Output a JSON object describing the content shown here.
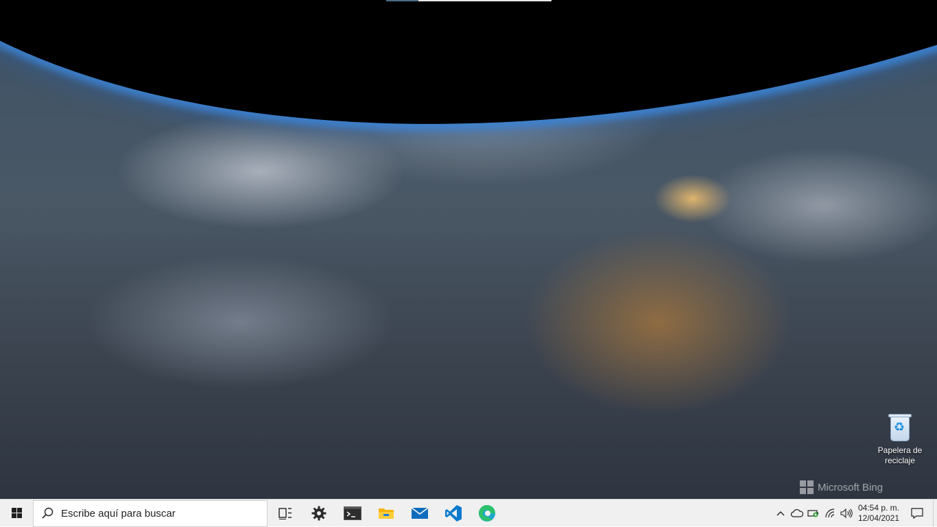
{
  "desktop": {
    "icons": [
      {
        "label": "Papelera de reciclaje",
        "icon": "recycle-bin-icon"
      }
    ],
    "watermark": "Microsoft Bing"
  },
  "taskbar": {
    "start_icon": "windows-logo-icon",
    "search": {
      "placeholder": "Escribe aquí para buscar",
      "icon": "search-icon"
    },
    "pinned": [
      {
        "name": "task-view",
        "icon": "task-view-icon"
      },
      {
        "name": "settings",
        "icon": "gear-icon"
      },
      {
        "name": "terminal",
        "icon": "terminal-icon"
      },
      {
        "name": "file-explorer",
        "icon": "folder-icon"
      },
      {
        "name": "mail",
        "icon": "mail-icon"
      },
      {
        "name": "vscode",
        "icon": "vscode-icon"
      },
      {
        "name": "edge",
        "icon": "edge-icon"
      }
    ],
    "tray": {
      "icons": [
        "chevron-up-icon",
        "onedrive-cloud-icon",
        "battery-charging-icon",
        "wifi-icon",
        "volume-icon"
      ],
      "time": "04:54 p. m.",
      "date": "12/04/2021",
      "action_center_icon": "notification-icon"
    }
  },
  "colors": {
    "taskbar_bg": "#f0f0f0",
    "vscode_blue": "#0a7acc",
    "explorer_yellow": "#f4b400",
    "mail_blue": "#0f6cbd",
    "edge_teal": "#1fa8c9"
  }
}
